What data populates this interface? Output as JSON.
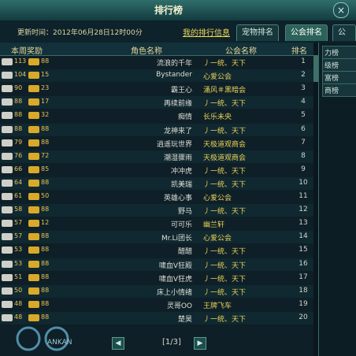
{
  "window": {
    "title": "排行榜",
    "close_label": "×"
  },
  "info": {
    "update_text": "更新时间：2012年06月28日12时00分",
    "self_link": "我的排行信息"
  },
  "tabs": [
    {
      "label": "宠物排名",
      "active": false
    },
    {
      "label": "公会排名",
      "active": true
    },
    {
      "label": "公会",
      "active": false
    }
  ],
  "columns": {
    "rank": "排名",
    "guild": "公会名称",
    "name": "角色名称",
    "reward": "本周奖励"
  },
  "rows": [
    {
      "rank": "1",
      "guild": "丿一统、天下",
      "name": "流浪的千年",
      "r1": "113",
      "r2": "88"
    },
    {
      "rank": "2",
      "guild": "心爱公会",
      "name": "Bystander",
      "r1": "104",
      "r2": "15"
    },
    {
      "rank": "3",
      "guild": "涌风＃黑暗会",
      "name": "霸王心",
      "r1": "90",
      "r2": "23"
    },
    {
      "rank": "4",
      "guild": "丿一统、天下",
      "name": "再续前缘",
      "r1": "88",
      "r2": "17"
    },
    {
      "rank": "5",
      "guild": "长乐未央",
      "name": "痴情",
      "r1": "88",
      "r2": "32"
    },
    {
      "rank": "6",
      "guild": "丿一统、天下",
      "name": "龙神来了",
      "r1": "88",
      "r2": "88"
    },
    {
      "rank": "7",
      "guild": "天极道观商会",
      "name": "逍遥玩世界",
      "r1": "79",
      "r2": "88"
    },
    {
      "rank": "8",
      "guild": "天极道观商会",
      "name": "潮湿骤雨",
      "r1": "76",
      "r2": "72"
    },
    {
      "rank": "9",
      "guild": "丿一统、天下",
      "name": "冲冲虎",
      "r1": "66",
      "r2": "85"
    },
    {
      "rank": "10",
      "guild": "丿一统、天下",
      "name": "凯美瑞",
      "r1": "64",
      "r2": "88"
    },
    {
      "rank": "11",
      "guild": "心爱公会",
      "name": "英雄心事",
      "r1": "61",
      "r2": "50"
    },
    {
      "rank": "12",
      "guild": "丿一统、天下",
      "name": "野马",
      "r1": "58",
      "r2": "88"
    },
    {
      "rank": "13",
      "guild": "幽兰轩",
      "name": "可可乐",
      "r1": "57",
      "r2": "12"
    },
    {
      "rank": "14",
      "guild": "心爱公会",
      "name": "Mr.Li团长",
      "r1": "57",
      "r2": "88"
    },
    {
      "rank": "15",
      "guild": "丿一统、天下",
      "name": "醋醋",
      "r1": "53",
      "r2": "88"
    },
    {
      "rank": "16",
      "guild": "丿一统、天下",
      "name": "啸血V狂殿",
      "r1": "53",
      "r2": "88"
    },
    {
      "rank": "17",
      "guild": "丿一统、天下",
      "name": "啸血V狂虎",
      "r1": "51",
      "r2": "88"
    },
    {
      "rank": "18",
      "guild": "丿一统、天下",
      "name": "床上小情绪",
      "r1": "50",
      "r2": "88"
    },
    {
      "rank": "19",
      "guild": "王牌飞车",
      "name": "灵哥OO",
      "r1": "48",
      "r2": "88"
    },
    {
      "rank": "20",
      "guild": "丿一统、天下",
      "name": "楚昊",
      "r1": "48",
      "r2": "88"
    }
  ],
  "pager": {
    "info": "[1/3]",
    "prev": "◀",
    "next": "▶"
  },
  "right_panel": {
    "items": [
      "力榜",
      "级榜",
      "富榜",
      "商榜"
    ]
  },
  "logo": {
    "text": "ANKAN"
  }
}
